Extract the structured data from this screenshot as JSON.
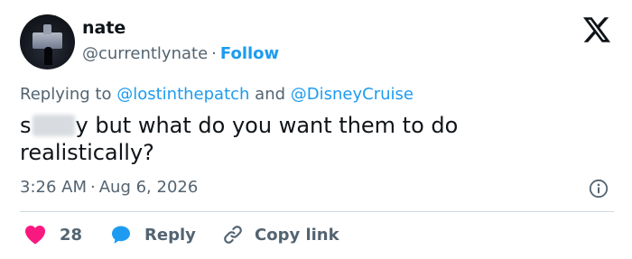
{
  "author": {
    "name": "nate",
    "handle": "@currentlynate",
    "separator": "·",
    "follow_label": "Follow"
  },
  "replying": {
    "prefix": "Replying to",
    "mention_1": "@lostinthepatch",
    "conjunction": "and",
    "mention_2": "@DisneyCruise"
  },
  "tweet": {
    "text_start": "s",
    "text_rest": "y but what do you want them to do realistically?"
  },
  "meta": {
    "time": "3:26 AM",
    "separator": "·",
    "date": "Aug 6, 2026"
  },
  "actions": {
    "like_count": "28",
    "reply_label": "Reply",
    "copy_label": "Copy link"
  },
  "colors": {
    "accent": "#1d9bf0",
    "like": "#f91880",
    "secondary_text": "#536471",
    "primary_text": "#0f1419"
  },
  "icons": {
    "logo": "x-logo-icon",
    "info": "info-icon",
    "like": "heart-icon",
    "reply": "speech-bubble-icon",
    "copy": "link-icon"
  }
}
